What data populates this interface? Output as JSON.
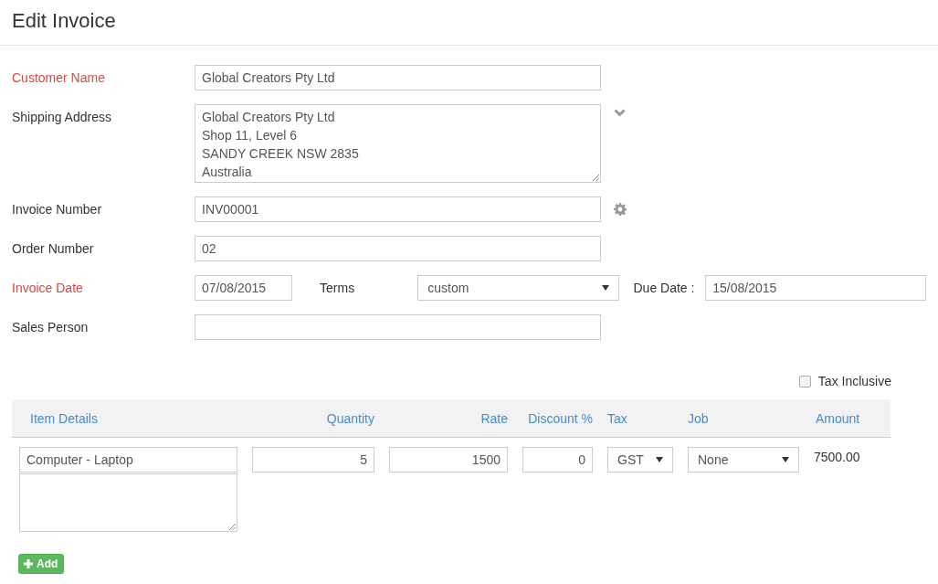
{
  "page": {
    "title": "Edit Invoice"
  },
  "fields": [
    {
      "kind": "text",
      "label": "Customer Name",
      "required": true,
      "value": "Global Creators Pty Ltd"
    },
    {
      "kind": "address",
      "label": "Shipping Address",
      "required": false,
      "value": "Global Creators Pty Ltd\nShop 11, Level 6\nSANDY CREEK NSW 2835\nAustralia"
    },
    {
      "kind": "invoice_number",
      "label": "Invoice Number",
      "required": false,
      "value": "INV00001"
    },
    {
      "kind": "text",
      "label": "Order Number",
      "required": false,
      "value": "02"
    },
    {
      "kind": "dates",
      "label": "Invoice Date",
      "required": true,
      "value": "07/08/2015",
      "terms_label": "Terms",
      "terms": "custom",
      "due_label": "Due Date :",
      "due_value": "15/08/2015"
    },
    {
      "kind": "text",
      "label": "Sales Person",
      "required": false
    }
  ],
  "tax_inclusive": {
    "label": "Tax Inclusive",
    "checked": false
  },
  "items": {
    "columns": [
      "Item Details",
      "Quantity",
      "Rate",
      "Discount %",
      "Tax",
      "Job",
      "Amount"
    ],
    "rows": [
      {
        "item": "Computer - Laptop",
        "quantity": "5",
        "rate": "1500",
        "discount": "0",
        "tax": "GST",
        "job": "None",
        "amount": "7500.00"
      }
    ]
  },
  "add_button": "Add"
}
